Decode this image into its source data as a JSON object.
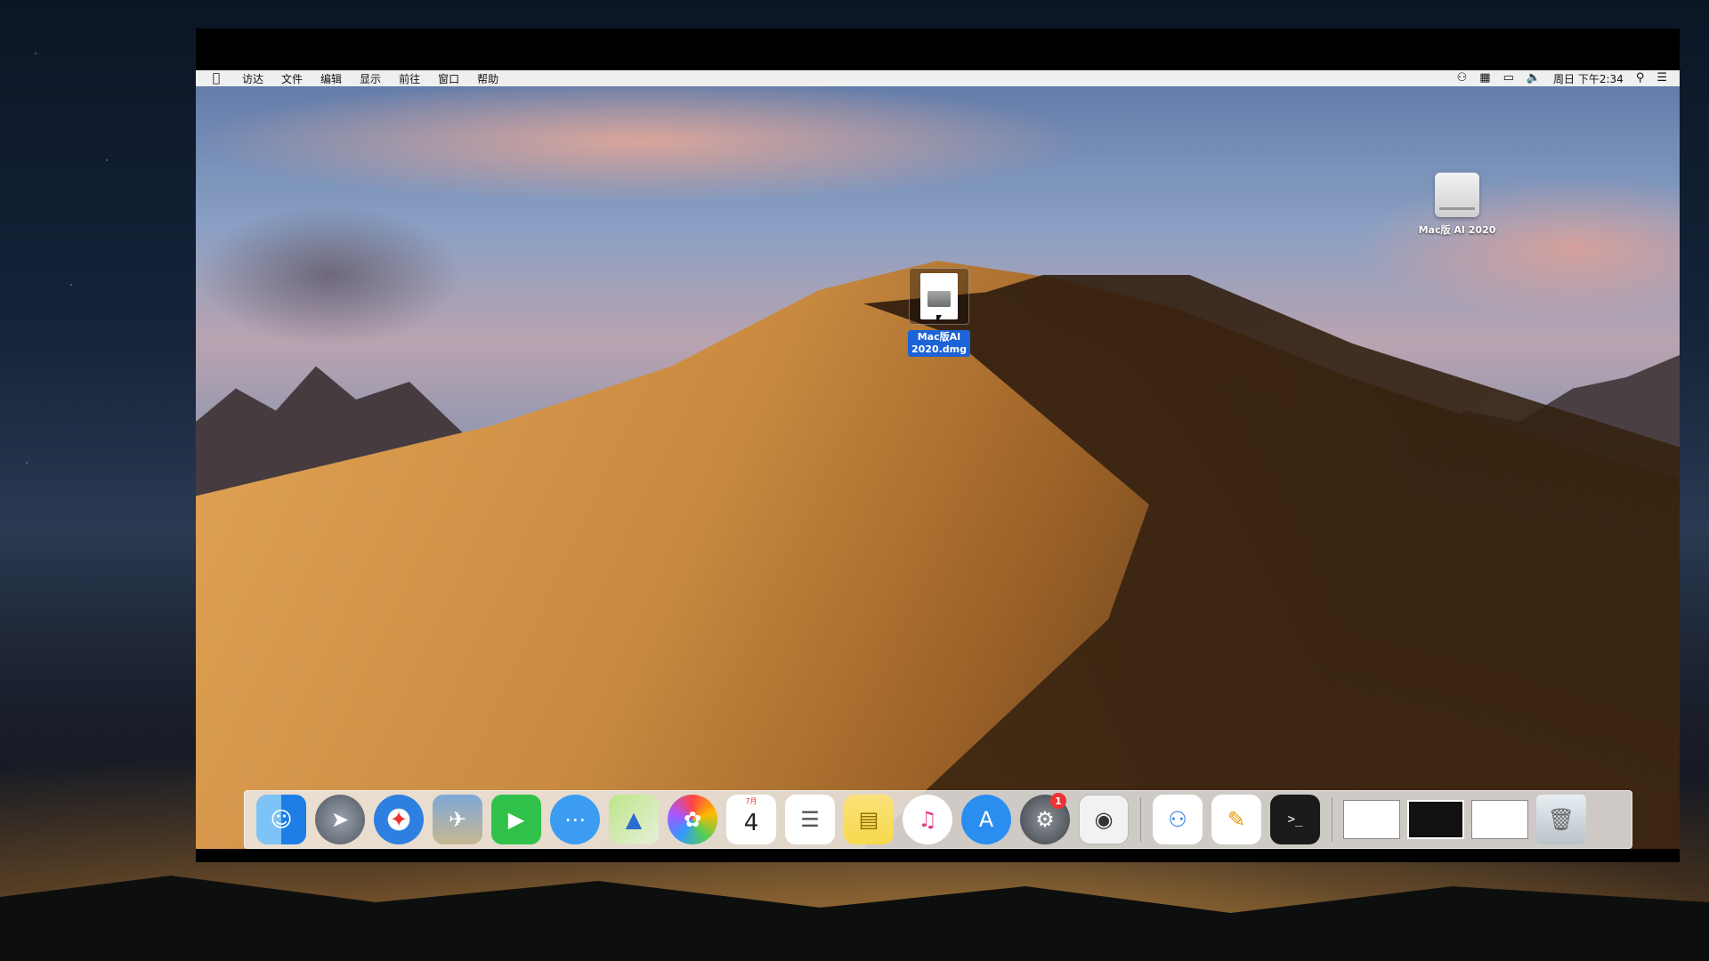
{
  "menubar": {
    "apple": "",
    "items": [
      "访达",
      "文件",
      "编辑",
      "显示",
      "前往",
      "窗口",
      "帮助"
    ],
    "status": {
      "clock": "周日 下午2:34"
    }
  },
  "desktop": {
    "disk_label": "Mac版 AI 2020",
    "dmg_label_line1": "Mac版AI",
    "dmg_label_line2": "2020.dmg"
  },
  "dock": {
    "calendar_month": "7月",
    "calendar_day": "4",
    "system_prefs_badge": "1",
    "terminal_prompt": ">_"
  },
  "icons": {
    "finder": "finder-icon",
    "launchpad": "rocket-icon",
    "safari": "compass-icon",
    "preview": "eagle-photo-icon",
    "facetime": "video-camera-icon",
    "messages": "speech-bubble-icon",
    "maps": "map-icon",
    "photos": "flower-icon",
    "calendar": "calendar-icon",
    "reminders": "checklist-icon",
    "notes": "notepad-icon",
    "itunes": "music-note-icon",
    "appstore": "app-store-icon",
    "sysprefs": "gear-icon",
    "screenshot": "camera-icon",
    "baidu": "cloud-rings-icon",
    "pages": "pencil-icon",
    "terminal": "terminal-icon",
    "trash": "trash-icon"
  }
}
